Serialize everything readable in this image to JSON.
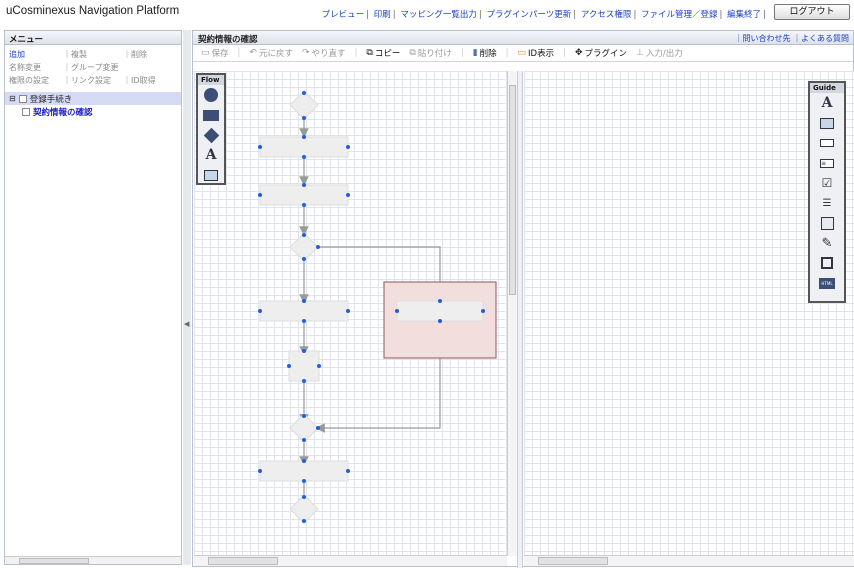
{
  "app_title": "uCosminexus Navigation Platform",
  "top_nav": [
    "プレビュー",
    "印刷",
    "マッピング一覧出力",
    "プラグインパーツ更新",
    "アクセス権限",
    "ファイル管理／登録",
    "編集終了"
  ],
  "logout_label": "ログアウト",
  "left_panel": {
    "title": "メニュー",
    "menu": [
      [
        "追加",
        "複製",
        "削除"
      ],
      [
        "名称変更",
        "グループ変更",
        ""
      ],
      [
        "権限の設定",
        "リンク設定",
        "ID取得"
      ]
    ],
    "tree_parent": "登録手続き",
    "tree_child": "契約情報の確認"
  },
  "main_panel": {
    "title": "契約情報の確認",
    "links": [
      "問い合わせ先",
      "よくある質問"
    ],
    "toolbar": [
      {
        "icon": "save-icon",
        "label": "保存",
        "enabled": false
      },
      {
        "icon": "undo-icon",
        "label": "元に戻す",
        "enabled": false
      },
      {
        "icon": "redo-icon",
        "label": "やり直す",
        "enabled": false
      },
      {
        "icon": "copy-icon",
        "label": "コピー",
        "enabled": true
      },
      {
        "icon": "paste-icon",
        "label": "貼り付け",
        "enabled": false
      },
      {
        "icon": "trash-icon",
        "label": "削除",
        "enabled": true
      },
      {
        "icon": "id-icon",
        "label": "ID表示",
        "enabled": true
      },
      {
        "icon": "plugin-icon",
        "label": "プラグイン",
        "enabled": true
      },
      {
        "icon": "io-icon",
        "label": "入力/出力",
        "enabled": false
      }
    ]
  },
  "flow_palette": {
    "title": "Flow",
    "items": [
      "circle-icon",
      "rectangle-icon",
      "diamond-icon",
      "text-icon",
      "image-icon"
    ]
  },
  "guide_palette": {
    "title": "Guide",
    "items": [
      "text-icon",
      "image-icon",
      "button-icon",
      "textbox-icon",
      "checkbox-icon",
      "list-icon",
      "listbox-icon",
      "pen-text-icon",
      "frame-icon",
      "html-icon"
    ]
  },
  "colors": {
    "link": "#1a3fc8",
    "node_fill": "#eeeeee",
    "selected_group": "#f3dede",
    "selected_border": "#9b7070",
    "dot": "#1f5fe0",
    "arrow": "#999999"
  }
}
